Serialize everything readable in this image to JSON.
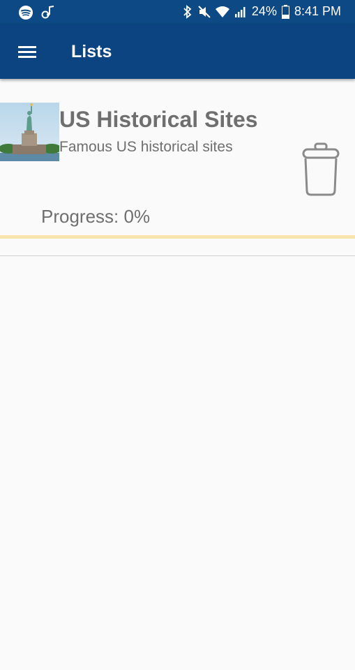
{
  "status_bar": {
    "battery_text": "24%",
    "time": "8:41 PM",
    "left_icons": [
      "spotify-icon",
      "music-note-icon"
    ],
    "right_icons": [
      "bluetooth-icon",
      "mute-icon",
      "wifi-icon",
      "signal-icon",
      "battery-icon"
    ]
  },
  "app_bar": {
    "title": "Lists",
    "menu_icon": "hamburger-menu-icon"
  },
  "lists": [
    {
      "title": "US Historical Sites",
      "subtitle": "Famous US historical sites",
      "progress_label": "Progress: 0%",
      "progress_fraction": 0.0,
      "thumbnail": "statue-of-liberty-image",
      "delete_icon": "trash-can-icon"
    }
  ],
  "colors": {
    "app_bar": "#0c4381",
    "status_bar": "#0d4a85",
    "text_gray": "#6f6f6f",
    "progress_track": "#fde3ad",
    "background": "#fafafa"
  }
}
